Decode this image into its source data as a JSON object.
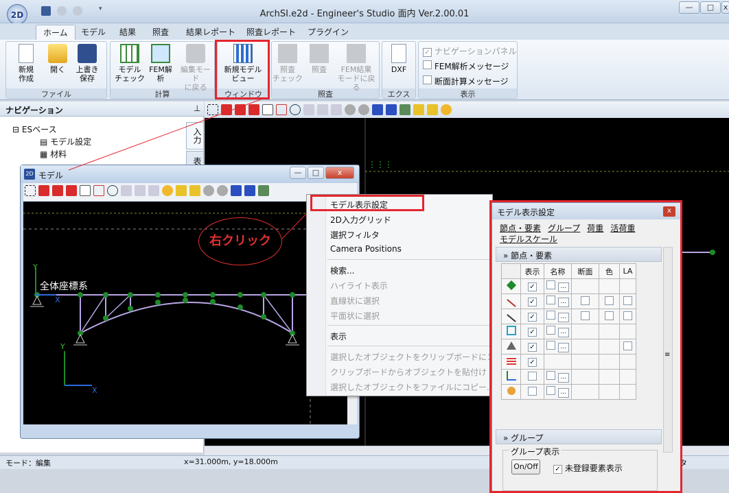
{
  "app": {
    "title": "ArchSI.e2d - Engineer's Studio 面内 Ver.2.00.01",
    "logo": "2D"
  },
  "tabs": [
    "ホーム",
    "モデル",
    "結果",
    "照査",
    "結果レポート",
    "照査レポート",
    "プラグイン"
  ],
  "ribbon": {
    "groups": {
      "file": "ファイル",
      "calc": "計算",
      "window": "ウィンドウ",
      "check": "照査",
      "export": "エクスポ...",
      "display": "表示"
    },
    "buttons": {
      "new": "新規\n作成",
      "open": "開く",
      "save": "上書き\n保存",
      "model_check": "モデル\nチェック",
      "fem": "FEM解\n析",
      "edit_back": "編集モード\nに戻る",
      "new_view": "新規モデル\nビュー",
      "chk_check": "照査\nチェック",
      "chk": "照査",
      "fem_back": "FEM結果\nモードに戻る",
      "dxf": "DXF"
    },
    "checks": [
      {
        "label": "ナビゲーションパネル",
        "checked": true,
        "disabled": true
      },
      {
        "label": "FEM解析メッセージ",
        "checked": false,
        "disabled": false
      },
      {
        "label": "断面計算メッセージ",
        "checked": false,
        "disabled": false
      }
    ]
  },
  "nav": {
    "title": "ナビゲーション",
    "pin": "ᵖ",
    "tree": [
      "ESベース",
      "モデル設定",
      "材料"
    ],
    "sidetabs": [
      "入力",
      "表"
    ]
  },
  "model_window": {
    "title": "モデル",
    "coord_label": "全体座標系",
    "axis_x": "X",
    "axis_y": "Y"
  },
  "annotation": {
    "text": "右クリック"
  },
  "context_menu": {
    "items": [
      {
        "label": "モデル表示設定",
        "disabled": false
      },
      {
        "label": "2D入力グリッド",
        "disabled": false
      },
      {
        "label": "選択フィルタ",
        "disabled": false
      },
      {
        "label": "Camera Positions",
        "disabled": false
      },
      {
        "label": "検索...",
        "disabled": false
      },
      {
        "label": "ハイライト表示",
        "disabled": true
      },
      {
        "label": "直線状に選択",
        "disabled": true
      },
      {
        "label": "平面状に選択",
        "disabled": true
      },
      {
        "label": "表示",
        "disabled": false
      },
      {
        "label": "選択したオブジェクトをクリップボードにコ",
        "disabled": true
      },
      {
        "label": "クリップボードからオブジェクトを貼付け",
        "disabled": true
      },
      {
        "label": "選択したオブジェクトをファイルにコピー...",
        "disabled": true
      }
    ]
  },
  "dialog": {
    "title": "モデル表示設定",
    "close": "x",
    "links": [
      "節点・要素",
      "グループ",
      "荷重",
      "活荷重",
      "モデルスケール"
    ],
    "section1": "節点・要素",
    "columns": [
      "表示",
      "名称",
      "断面",
      "色",
      "LA"
    ],
    "rows": [
      {
        "show": true,
        "name_btn": true,
        "section": false,
        "color": false,
        "la": false
      },
      {
        "show": true,
        "name_btn": true,
        "section": true,
        "color": true,
        "la": true
      },
      {
        "show": true,
        "name_btn": true,
        "section": true,
        "color": true,
        "la": true
      },
      {
        "show": true,
        "name_btn": true,
        "section": false,
        "color": false,
        "la": false
      },
      {
        "show": true,
        "name_btn": true,
        "section": false,
        "color": false,
        "la": true
      },
      {
        "show": true,
        "name_btn": false,
        "section": false,
        "color": false,
        "la": false
      },
      {
        "show": false,
        "name_btn": true,
        "section": false,
        "color": false,
        "la": false
      },
      {
        "show": false,
        "name_btn": true,
        "section": false,
        "color": false,
        "la": false
      }
    ],
    "section2": "グループ",
    "group_display": "グループ表示",
    "onoff": "On/Off",
    "unregistered": "未登録要素表示",
    "ellipsis": "..."
  },
  "status": {
    "mode": "モード：編集",
    "coords": "x=31.000m, y=18.000m",
    "tail": "タ"
  },
  "colors": {
    "accent": "#e4262e",
    "node": "#1e8a2a",
    "member": "#b9a6e6"
  }
}
